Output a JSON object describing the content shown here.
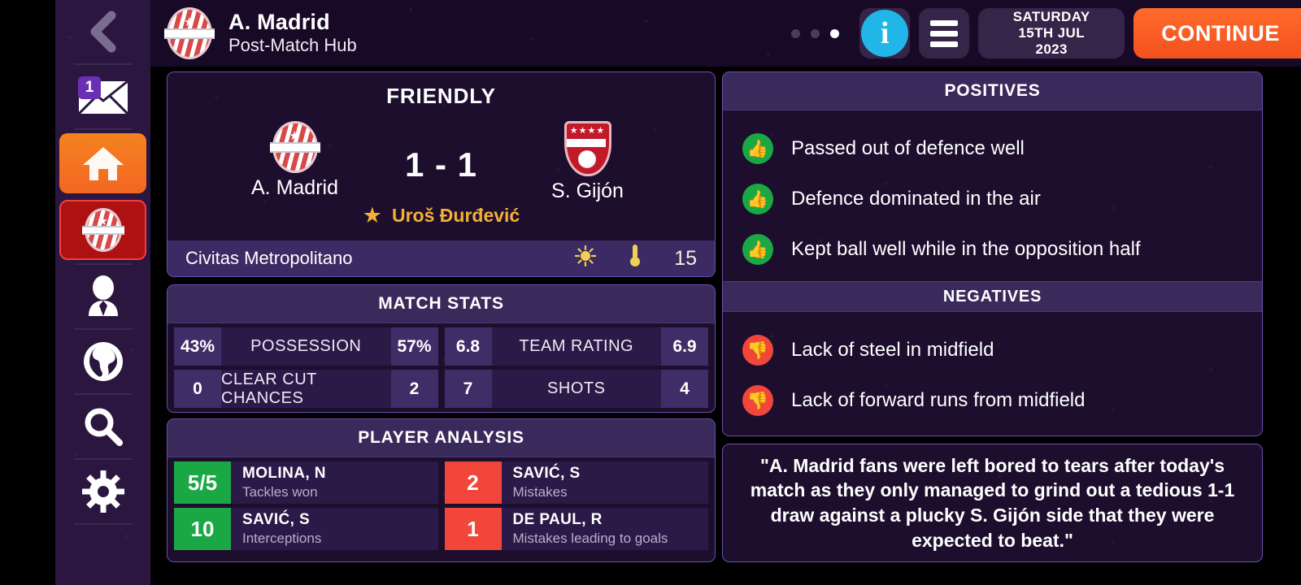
{
  "sidebar": {
    "items": [
      {
        "name": "back",
        "icon": "chevron-left-icon",
        "badge": null
      },
      {
        "name": "inbox",
        "icon": "envelope-icon",
        "badge": "1"
      },
      {
        "name": "home",
        "icon": "home-icon",
        "badge": null
      },
      {
        "name": "club",
        "icon": "club-crest-icon",
        "badge": null
      },
      {
        "name": "manager",
        "icon": "manager-icon",
        "badge": null
      },
      {
        "name": "world",
        "icon": "globe-icon",
        "badge": null
      },
      {
        "name": "search",
        "icon": "magnifier-icon",
        "badge": null
      },
      {
        "name": "settings",
        "icon": "gear-icon",
        "badge": null
      }
    ]
  },
  "header": {
    "club_crest": "a-madrid-crest-icon",
    "title": "A. Madrid",
    "subtitle": "Post-Match Hub",
    "pager_dots": 3,
    "pager_active_index": 2,
    "info_glyph": "i",
    "menu_icon": "hamburger-icon",
    "date": {
      "weekday": "SATURDAY",
      "day": "15TH JUL",
      "year": "2023"
    },
    "continue_label": "CONTINUE",
    "accent_color": "#f4511f"
  },
  "match": {
    "competition": "FRIENDLY",
    "home": {
      "name": "A. Madrid",
      "crest": "a-madrid-crest-icon"
    },
    "away": {
      "name": "S. Gijón",
      "crest": "s-gijon-crest-icon"
    },
    "score": "1 - 1",
    "man_of_the_match": "Uroš Đurđević",
    "man_of_the_match_icon": "star-icon",
    "motm_color": "#f2b134",
    "venue": "Civitas Metropolitano",
    "weather_icon": "sun-icon",
    "temperature_icon": "thermometer-icon",
    "temperature": "15"
  },
  "stats": {
    "title": "MATCH STATS",
    "rows": [
      {
        "label": "POSSESSION",
        "home": "43%",
        "away": "57%"
      },
      {
        "label": "TEAM RATING",
        "home": "6.8",
        "away": "6.9"
      },
      {
        "label": "CLEAR CUT CHANCES",
        "home": "0",
        "away": "2"
      },
      {
        "label": "SHOTS",
        "home": "7",
        "away": "4"
      }
    ]
  },
  "players": {
    "title": "PLAYER ANALYSIS",
    "items": [
      {
        "value": "5/5",
        "name": "MOLINA, N",
        "stat": "Tackles won",
        "tone": "good"
      },
      {
        "value": "2",
        "name": "SAVIĆ, S",
        "stat": "Mistakes",
        "tone": "bad"
      },
      {
        "value": "10",
        "name": "SAVIĆ, S",
        "stat": "Interceptions",
        "tone": "good"
      },
      {
        "value": "1",
        "name": "DE PAUL, R",
        "stat": "Mistakes leading to goals",
        "tone": "bad"
      }
    ],
    "good_color": "#1aa844",
    "bad_color": "#f2463a"
  },
  "feedback": {
    "positives_title": "POSITIVES",
    "positives": [
      "Passed out of defence well",
      "Defence dominated in the air",
      "Kept ball well while in the opposition half"
    ],
    "negatives_title": "NEGATIVES",
    "negatives": [
      "Lack of steel in midfield",
      "Lack of forward runs from midfield"
    ]
  },
  "quote": {
    "text": "\"A. Madrid fans were left bored to tears after today's match as they only managed to grind out a tedious 1-1 draw against a plucky S. Gijón side that they were expected to beat.\""
  }
}
